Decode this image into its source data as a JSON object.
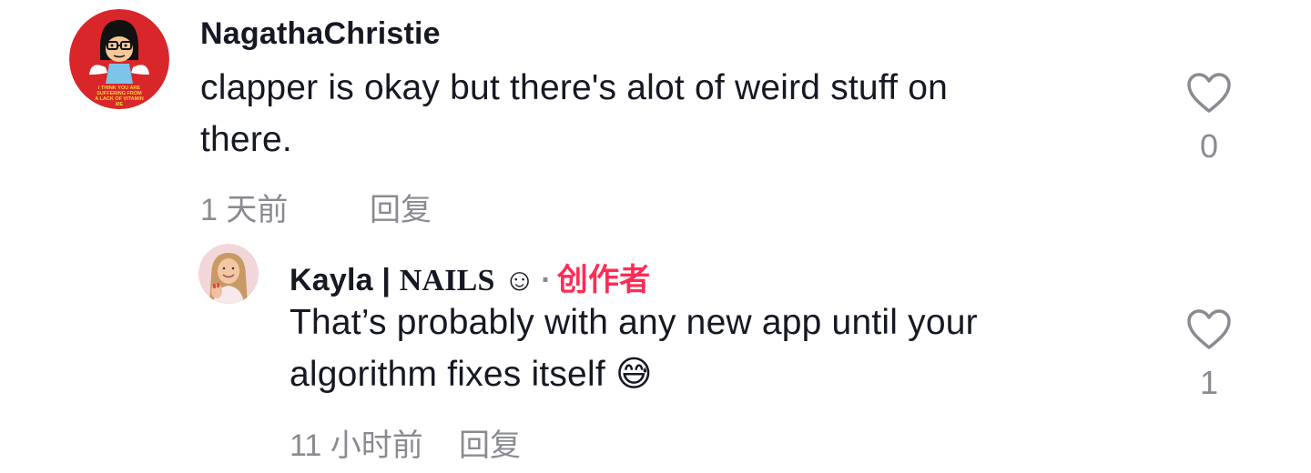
{
  "comments": [
    {
      "username": "NagathaChristie",
      "avatar_text": "I THINK YOU ARE SUFFERING FROM A LACK OF VITAMIN ME",
      "text_line1": "clapper is okay but there's alot of weird stuff on",
      "text_line2": "there.",
      "time": "1 天前",
      "reply_label": "回复",
      "like_count": "0",
      "like_icon": "heart-outline-icon"
    },
    {
      "username_part1": "Kayla | ",
      "username_part2": "NAILS",
      "username_emoji": "☺",
      "separator": "·",
      "creator_label": "创作者",
      "text_line1": "That’s probably with any new app until your",
      "text_line2": "algorithm fixes itself",
      "text_emoji": "😅",
      "time": "11 小时前",
      "reply_label": "回复",
      "like_count": "1",
      "like_icon": "heart-outline-icon"
    }
  ],
  "colors": {
    "text_primary": "#161823",
    "text_secondary": "#8a8b91",
    "creator_accent": "#fe2c55",
    "avatar1_bg": "#d8262a"
  }
}
